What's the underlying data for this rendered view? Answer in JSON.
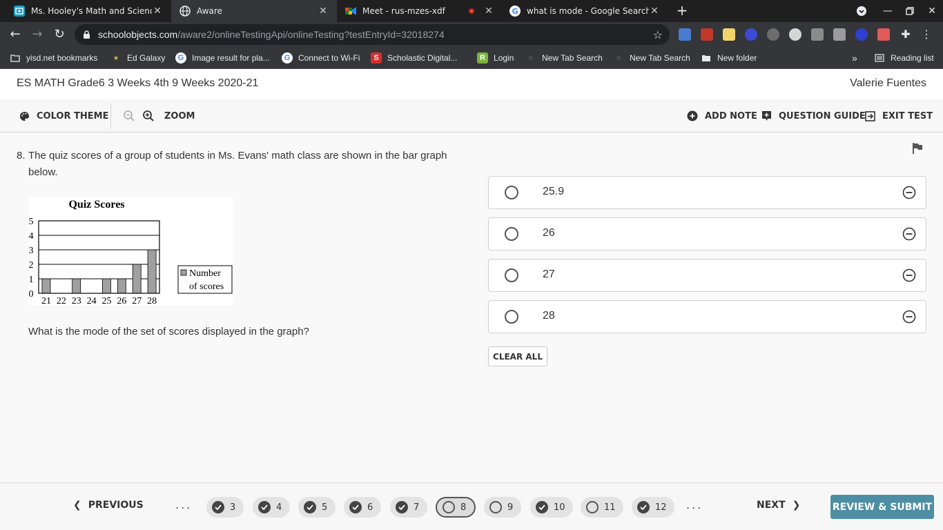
{
  "browser": {
    "tabs": [
      {
        "title": "Ms. Hooley's Math and Science F",
        "favicon_color": "#1a9dc4"
      },
      {
        "title": "Aware",
        "favicon_color": "#e8eaed"
      },
      {
        "title": "Meet - rus-mzes-xdf",
        "favicon_color": "#00832d"
      },
      {
        "title": "what is mode - Google Search",
        "favicon_color": "#ffffff"
      }
    ],
    "url_host": "schoolobjects.com",
    "url_path": "/aware2/onlineTestingApi/onlineTesting?testEntryId=32018274",
    "bookmarks": [
      "yisd.net bookmarks",
      "Ed Galaxy",
      "Image result for pla...",
      "Connect to Wi-Fi",
      "Scholastic Digital...",
      "Login",
      "New Tab Search",
      "New Tab Search",
      "New folder"
    ],
    "reading_list": "Reading list",
    "overflow": "»"
  },
  "header": {
    "title": "ES MATH Grade6 3 Weeks 4th 9 Weeks 2020-21",
    "user": "Valerie Fuentes"
  },
  "toolbar": {
    "color_theme": "COLOR THEME",
    "zoom": "ZOOM",
    "add_note": "ADD NOTE",
    "question_guide": "QUESTION GUIDE",
    "exit_test": "EXIT TEST"
  },
  "question": {
    "number": "8.",
    "text": "The quiz scores of a group of students in Ms. Evans' math class are shown in the bar graph below.",
    "prompt": "What is the mode of the set of scores displayed in the graph?"
  },
  "chart_data": {
    "type": "bar",
    "title": "Quiz Scores",
    "categories": [
      "21",
      "22",
      "23",
      "24",
      "25",
      "26",
      "27",
      "28"
    ],
    "series": [
      {
        "name": "Number of scores",
        "values": [
          1,
          0,
          1,
          0,
          1,
          1,
          2,
          3
        ]
      }
    ],
    "ylim": [
      0,
      5
    ],
    "yticks": [
      "0",
      "1",
      "2",
      "3",
      "4",
      "5"
    ],
    "legend_lines": [
      "Number",
      "of scores"
    ],
    "legend_position": "right",
    "grid": true,
    "bar_color": "#a0a0a0"
  },
  "options": [
    {
      "value": "25.9"
    },
    {
      "value": "26"
    },
    {
      "value": "27"
    },
    {
      "value": "28"
    }
  ],
  "clear_all": "CLEAR ALL",
  "footer": {
    "previous": "PREVIOUS",
    "next": "NEXT",
    "ellipsis": "...",
    "review_submit": "REVIEW & SUBMIT",
    "questions": [
      {
        "n": "3",
        "answered": true
      },
      {
        "n": "4",
        "answered": true
      },
      {
        "n": "5",
        "answered": true
      },
      {
        "n": "6",
        "answered": true
      },
      {
        "n": "7",
        "answered": true
      },
      {
        "n": "8",
        "answered": false,
        "current": true
      },
      {
        "n": "9",
        "answered": false
      },
      {
        "n": "10",
        "answered": true
      },
      {
        "n": "11",
        "answered": false
      },
      {
        "n": "12",
        "answered": true
      }
    ]
  }
}
